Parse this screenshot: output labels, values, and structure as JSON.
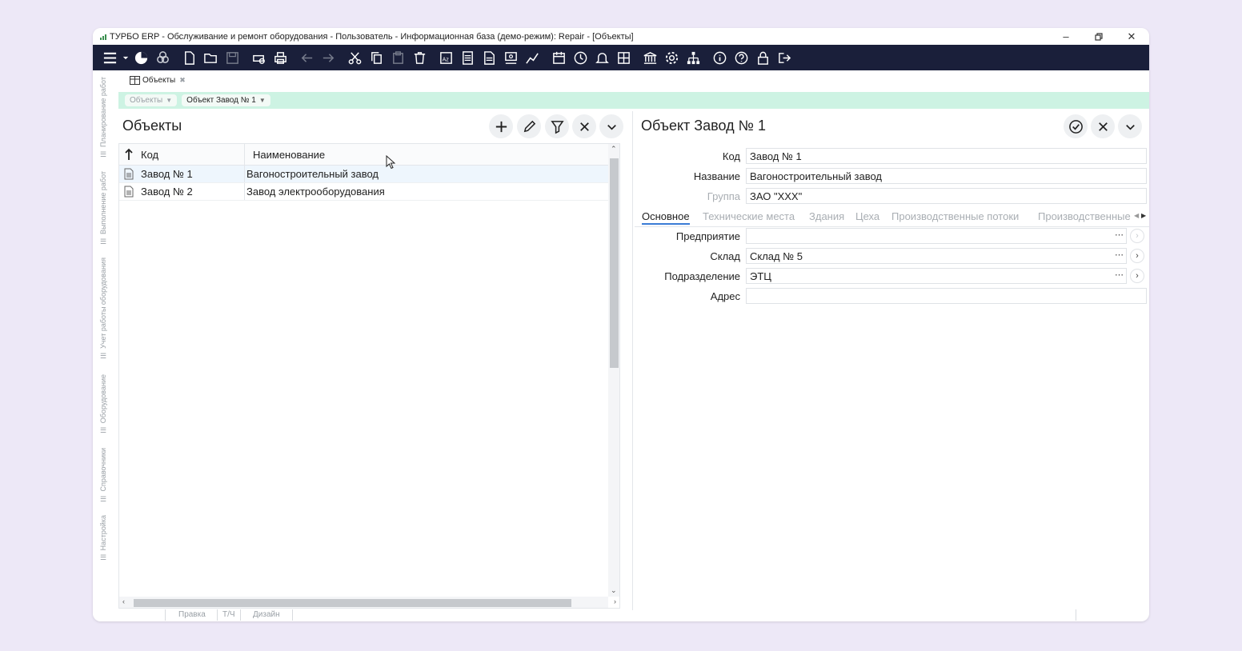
{
  "window": {
    "title": "ТУРБО ERP - Обслуживание и ремонт оборудования - Пользователь - Информационная база (демо-режим): Repair - [Объекты]"
  },
  "toolbar_icons": [
    "menu-icon",
    "chevron-down-icon",
    "pie-chart-icon",
    "objects-icon",
    "new-document-icon",
    "open-folder-icon",
    "save-icon",
    "print-preview-icon",
    "print-icon",
    "back-arrow-icon",
    "forward-arrow-icon",
    "cut-icon",
    "copy-icon",
    "paste-icon",
    "delete-icon",
    "report-az-icon",
    "list-report-icon",
    "document-report-icon",
    "stamp-icon",
    "chart-icon",
    "calendar-icon",
    "clock-icon",
    "bell-icon",
    "grid-icon",
    "bank-icon",
    "settings-icon",
    "hierarchy-icon",
    "info-icon",
    "help-icon",
    "lock-icon",
    "exit-icon"
  ],
  "sidebar": {
    "items": [
      {
        "label": "Планирование работ"
      },
      {
        "label": "Выполнение работ"
      },
      {
        "label": "Учет работы оборудования"
      },
      {
        "label": "Оборудование"
      },
      {
        "label": "Справочники"
      },
      {
        "label": "Настройка"
      }
    ]
  },
  "tab": {
    "label": "Объекты"
  },
  "breadcrumbs": [
    {
      "label": "Объекты"
    },
    {
      "label": "Объект Завод № 1"
    }
  ],
  "list": {
    "title": "Объекты",
    "columns": {
      "code": "Код",
      "name": "Наименование"
    },
    "rows": [
      {
        "code": "Завод № 1",
        "name": "Вагоностроительный завод"
      },
      {
        "code": "Завод № 2",
        "name": "Завод электрооборудования"
      }
    ]
  },
  "form": {
    "title": "Объект Завод № 1",
    "fields": {
      "code_label": "Код",
      "code_value": "Завод № 1",
      "name_label": "Название",
      "name_value": "Вагоностроительный завод",
      "group_label": "Группа",
      "group_value": "ЗАО \"XXX\""
    },
    "tabs": [
      "Основное",
      "Технические места",
      "Здания",
      "Цеха",
      "Производственные потоки",
      "Производственные"
    ],
    "main_tab": {
      "enterprise_label": "Предприятие",
      "enterprise_value": "",
      "warehouse_label": "Склад",
      "warehouse_value": "Склад № 5",
      "division_label": "Подразделение",
      "division_value": "ЭТЦ",
      "address_label": "Адрес",
      "address_value": ""
    }
  },
  "statusbar": {
    "items": [
      "Правка",
      "Т/Ч",
      "Дизайн"
    ]
  },
  "colors": {
    "toolbar_bg": "#1a1f3a",
    "breadcrumb_bg": "#cdf3e3",
    "page_bg": "#ede8f7",
    "active_tab_underline": "#3a7bd5"
  }
}
